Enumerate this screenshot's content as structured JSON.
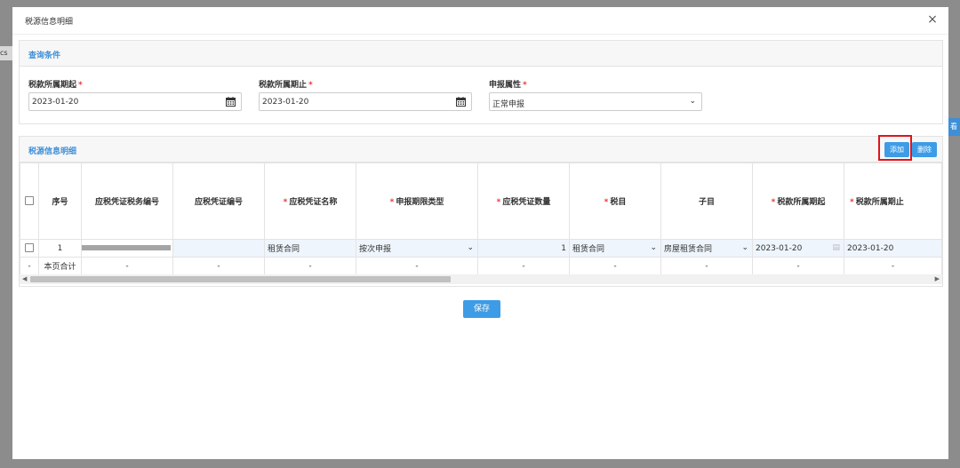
{
  "background": {
    "left_tab": "cs",
    "right_tab": "看"
  },
  "dialog": {
    "title": "税源信息明细",
    "close_label": "×",
    "query": {
      "section_title": "查询条件",
      "start_label": "税款所属期起",
      "start_value": "2023-01-20",
      "end_label": "税款所属期止",
      "end_value": "2023-01-20",
      "attr_label": "申报属性",
      "attr_value": "正常申报",
      "required_mark": "*"
    },
    "detail": {
      "section_title": "税源信息明细",
      "add_label": "添加",
      "delete_label": "删除",
      "columns": [
        "序号",
        "应税凭证税务编号",
        "应税凭证编号",
        "应税凭证名称",
        "申报期限类型",
        "应税凭证数量",
        "税目",
        "子目",
        "税款所属期起",
        "税款所属期止"
      ],
      "row": {
        "index": "1",
        "name": "租赁合同",
        "period_type": "按次申报",
        "quantity": "1",
        "item": "租赁合同",
        "subitem": "房屋租赁合同",
        "start": "2023-01-20",
        "end": "2023-01-20"
      },
      "total_row": {
        "mark": "-",
        "label": "本页合计",
        "dash": "-"
      }
    },
    "save_label": "保存"
  },
  "colors": {
    "accent": "#3e9ce6",
    "required": "#e53935",
    "highlight_box": "#e0141e"
  }
}
